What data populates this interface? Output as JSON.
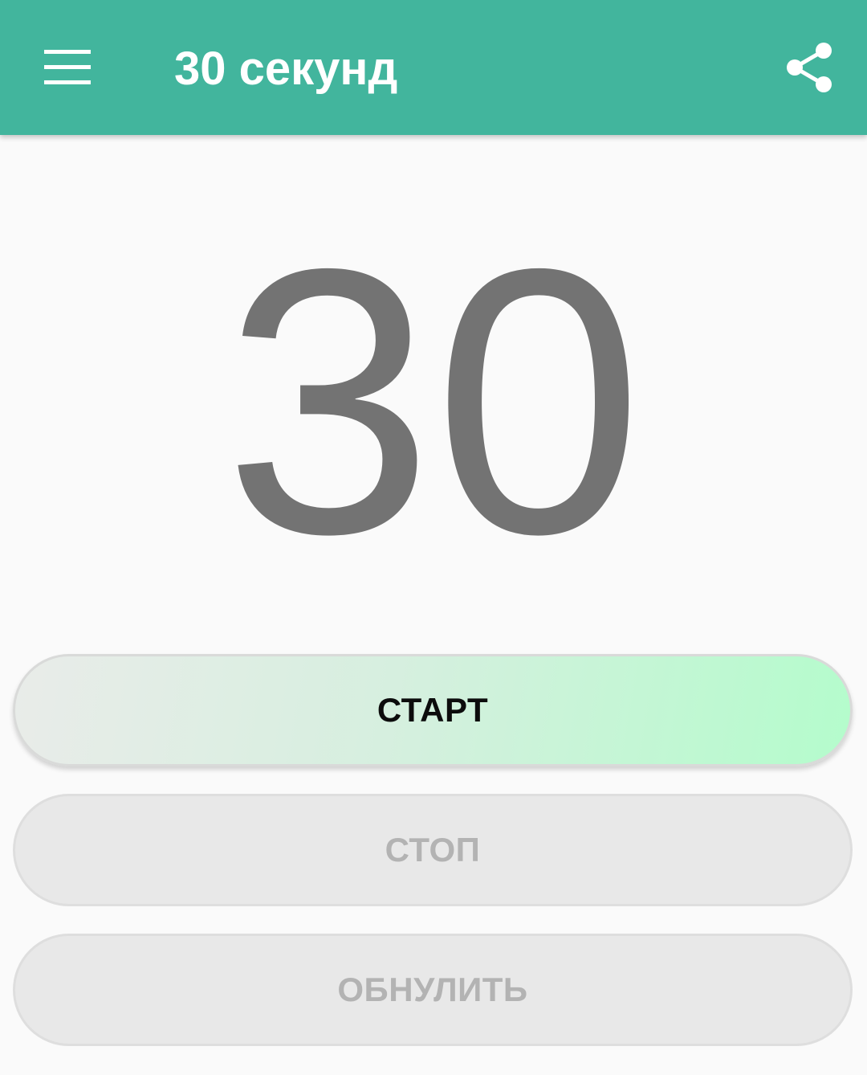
{
  "app_bar": {
    "menu_icon": "hamburger-menu-icon",
    "title": "30 секунд",
    "share_icon": "share-icon",
    "background_color": "#42b59d"
  },
  "timer": {
    "value": "30",
    "color": "#737373"
  },
  "buttons": {
    "start": {
      "label": "СТАРТ",
      "enabled": true
    },
    "stop": {
      "label": "СТОП",
      "enabled": false
    },
    "reset": {
      "label": "ОБНУЛИТЬ",
      "enabled": false
    }
  },
  "colors": {
    "accent": "#42b59d",
    "start_gradient_end": "#b4fccc",
    "disabled_text": "#b3b3b3"
  }
}
